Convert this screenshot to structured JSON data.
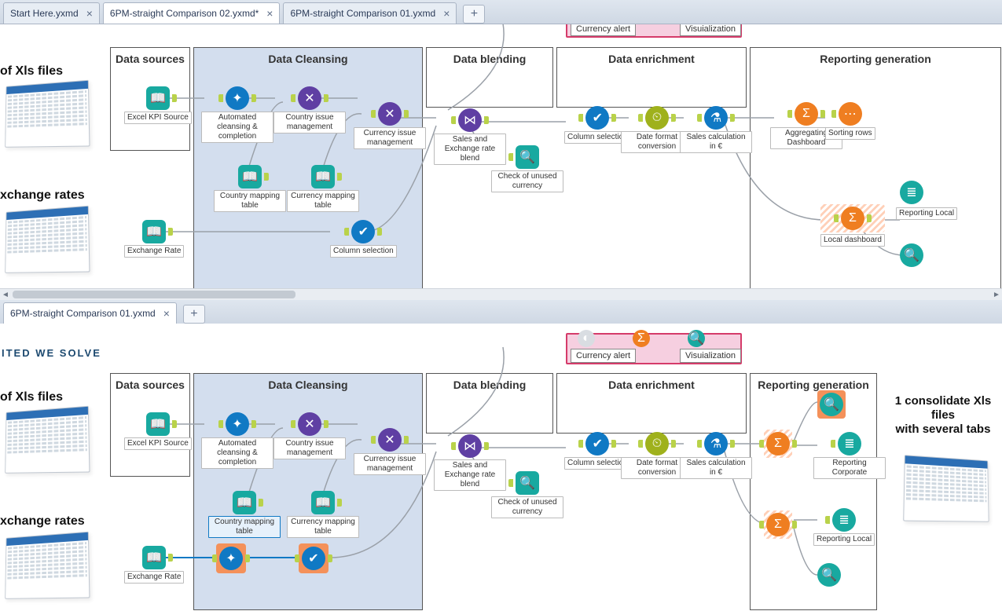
{
  "tabsTop": [
    {
      "label": "Start Here.yxmd",
      "active": false,
      "close": true
    },
    {
      "label": "6PM-straight Comparison 02.yxmd*",
      "active": true,
      "close": true
    },
    {
      "label": "6PM-straight Comparison 01.yxmd",
      "active": false,
      "close": true
    }
  ],
  "tabsBot": [
    {
      "label": "6PM-straight Comparison 01.yxmd",
      "active": true,
      "close": true
    }
  ],
  "edgeTitles": {
    "xls": "of Xls files",
    "rates": "xchange rates"
  },
  "tagline": "ITED WE SOLVE",
  "rightText": {
    "l1": "1 consolidate Xls",
    "l2": "files",
    "l3": "with several tabs"
  },
  "alerts": {
    "currency": "Currency alert",
    "viz": "Visuialization"
  },
  "containers": {
    "dataSources": "Data sources",
    "dataCleansing": "Data Cleansing",
    "dataBlending": "Data blending",
    "dataEnrichment": "Data enrichment",
    "reporting": "Reporting generation"
  },
  "nodes": {
    "excelKPI": "Excel KPI Source",
    "autoCleanse": "Automated cleansing & completion",
    "countryIssue": "Country issue management",
    "currencyIssue": "Currency issue management",
    "countryMap": "Country mapping table",
    "currencyMap": "Currency mapping table",
    "exchangeRate": "Exchange Rate",
    "columnSel": "Column selection",
    "salesBlend": "Sales and Exchange rate blend",
    "checkCurr": "Check of unused currency",
    "colSel2": "Column selection",
    "dateFmt": "Date format conversion",
    "salesCalc": "Sales calculation in €",
    "aggDash": "Aggregating Dashboard",
    "sortRows": "Sorting rows",
    "localDash": "Local dashboard",
    "reportLocal": "Reporting Local",
    "reportCorp": "Reporting Corporate"
  }
}
